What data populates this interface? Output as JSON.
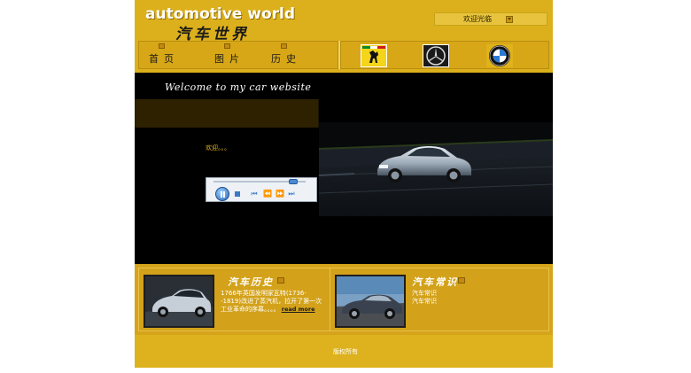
{
  "header": {
    "logo_text": "automotive world",
    "logo_subtitle": "汽车世界",
    "welcome_label": "欢迎光临"
  },
  "nav": {
    "items": [
      {
        "label": "首页"
      },
      {
        "label": "图片"
      },
      {
        "label": "历史"
      }
    ]
  },
  "brands": [
    {
      "name": "ferrari"
    },
    {
      "name": "mercedes-benz"
    },
    {
      "name": "bmw"
    }
  ],
  "main": {
    "welcome_script": "Welcome to my car website",
    "loading_text": "欢迎。。。"
  },
  "player": {
    "progress": 0.9,
    "state": "playing"
  },
  "panels": {
    "history": {
      "title": "汽车历史",
      "body": "1766年英国发明家瓦特(1736--1819)改进了蒸汽机，拉开了第一次工业革命的序幕。。。。",
      "read_more": "read more"
    },
    "common": {
      "title": "汽车常识",
      "lines": [
        "汽车常识",
        "汽车常识"
      ]
    }
  },
  "footer": {
    "text": "版权所有"
  },
  "colors": {
    "page_background": "#ddb21e",
    "main_background": "#000000",
    "accent_text": "#e0b41e",
    "white": "#ffffff"
  }
}
